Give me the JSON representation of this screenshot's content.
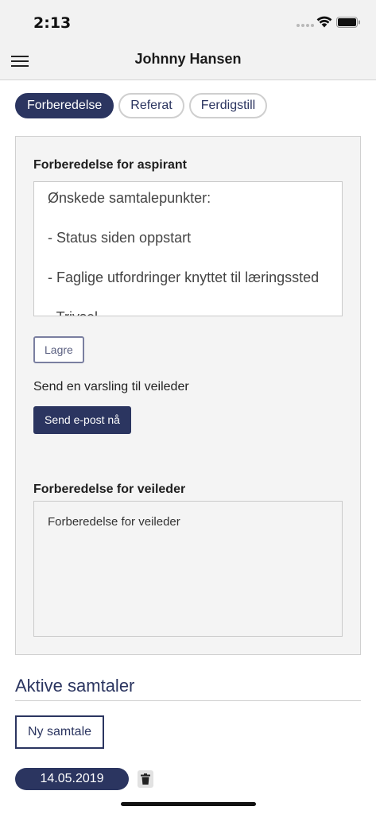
{
  "status_bar": {
    "time": "2:13",
    "icons": [
      "signal-dots-icon",
      "wifi-icon",
      "battery-icon"
    ]
  },
  "header": {
    "title": "Johnny Hansen",
    "menu_icon": "hamburger-menu-icon"
  },
  "tabs": [
    {
      "label": "Forberedelse",
      "active": true
    },
    {
      "label": "Referat",
      "active": false
    },
    {
      "label": "Ferdigstill",
      "active": false
    }
  ],
  "aspirant": {
    "heading": "Forberedelse for aspirant",
    "lines": [
      "Ønskede samtalepunkter:",
      "- Status siden oppstart",
      "- Faglige utfordringer knyttet til læringssted",
      "- Trivsel"
    ],
    "save_label": "Lagre"
  },
  "notify": {
    "text": "Send en varsling til veileder",
    "button_label": "Send e-post nå"
  },
  "veileder": {
    "heading": "Forberedelse for veileder",
    "placeholder": "Forberedelse for veileder"
  },
  "active_sessions": {
    "title": "Aktive samtaler",
    "new_label": "Ny samtale",
    "sessions": [
      {
        "date": "14.05.2019",
        "delete_icon": "trash-icon"
      }
    ]
  },
  "colors": {
    "primary": "#2b3560",
    "panel_bg": "#f4f4f4",
    "header_bg": "#f2f2f2"
  }
}
